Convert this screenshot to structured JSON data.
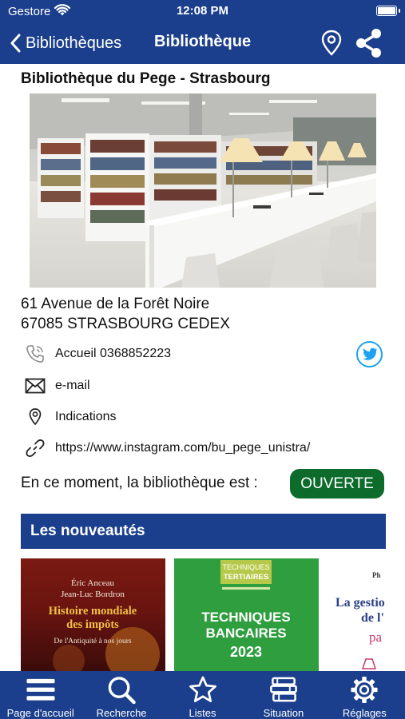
{
  "status_bar": {
    "carrier": "Gestore",
    "time": "12:08 PM"
  },
  "nav": {
    "back_label": "Bibliothèques",
    "title": "Bibliothèque"
  },
  "library": {
    "name": "Bibliothèque du Pege - Strasbourg",
    "address_line1": "61 Avenue de la Forêt Noire",
    "address_line2": "67085 STRASBOURG CEDEX",
    "phone": "Accueil 0368852223",
    "email": "e-mail",
    "directions": "Indications",
    "link": "https://www.instagram.com/bu_pege_unistra/",
    "status_text": "En ce moment, la bibliothèque est :",
    "status_value": "OUVERTE",
    "status_color": "#0d6b2c"
  },
  "news": {
    "title": "Les nouveautés",
    "books": [
      {
        "authors_line1": "Éric Anceau",
        "authors_line2": "Jean-Luc Bordron",
        "title_line1": "Histoire mondiale",
        "title_line2": "des impôts",
        "subtitle": "De l'Antiquité à nos jours"
      },
      {
        "series_line1": "TECHNIQUES",
        "series_line2": "TERTIAIRES",
        "title_line1": "TECHNIQUES",
        "title_line2": "BANCAIRES",
        "year": "2023"
      },
      {
        "corner": "Ph",
        "title_line1": "La gestio",
        "title_line2": "de l'",
        "title_line3": "pa"
      }
    ]
  },
  "tabs": [
    {
      "label": "Page d'accueil",
      "icon": "menu-icon"
    },
    {
      "label": "Recherche",
      "icon": "search-icon"
    },
    {
      "label": "Listes",
      "icon": "star-icon"
    },
    {
      "label": "Situation",
      "icon": "books-stack-icon"
    },
    {
      "label": "Réglages",
      "icon": "gear-icon"
    }
  ],
  "colors": {
    "brand": "#1b3f8c",
    "open": "#0d6b2c",
    "twitter": "#1da1f2"
  }
}
